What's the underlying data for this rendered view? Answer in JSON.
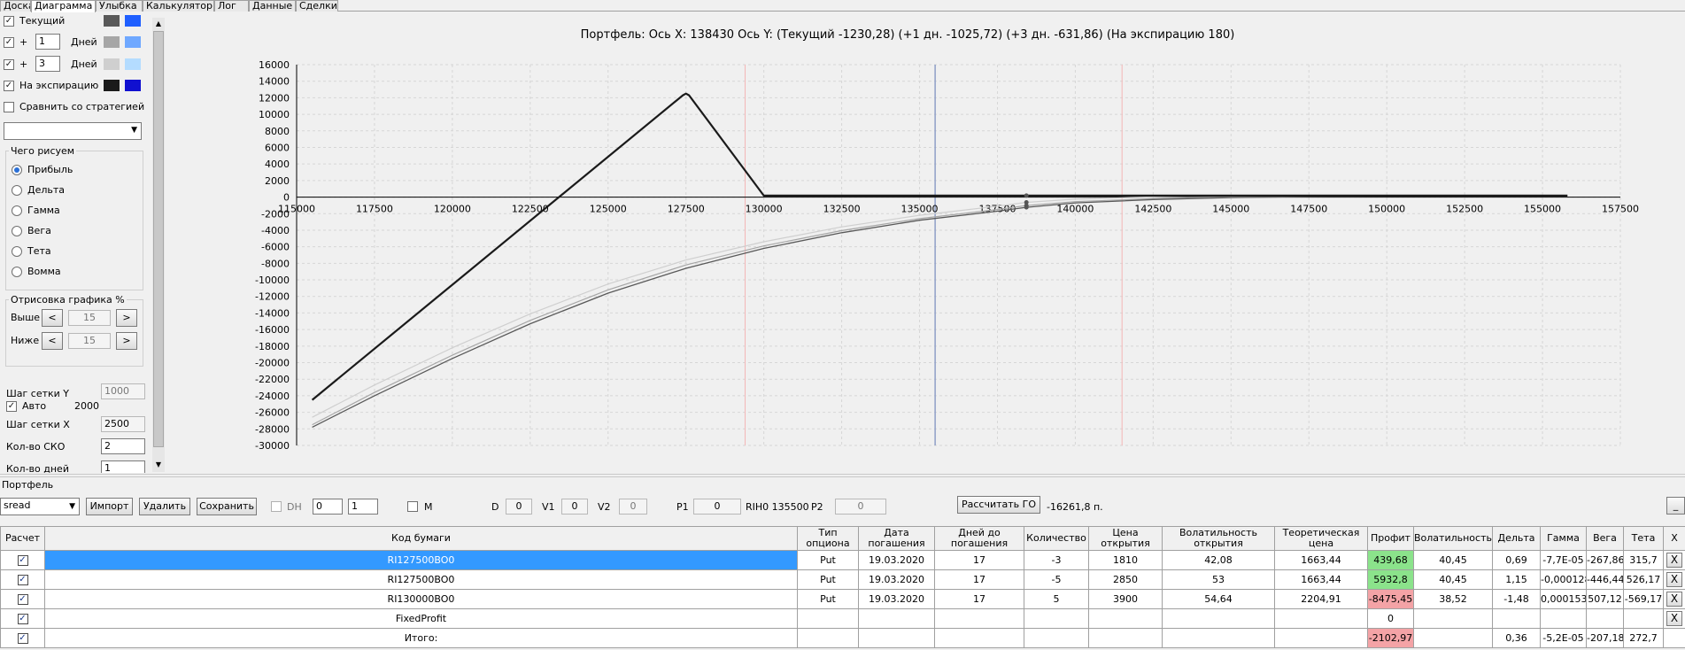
{
  "tabs": [
    "Доска",
    "Диаграмма",
    "Улыбка",
    "Калькулятор",
    "Лог",
    "Данные",
    "Сделки"
  ],
  "left_panel": {
    "current_label": "Текущий",
    "plus_sign": "+",
    "day1_value": "1",
    "day3_value": "3",
    "days_label": "Дней",
    "expiration_label": "На экспирацию",
    "compare_label": "Сравнить со стратегией",
    "what_draw_title": "Чего рисуем",
    "radio_options": [
      "Прибыль",
      "Дельта",
      "Гамма",
      "Вега",
      "Тета",
      "Вомма"
    ],
    "draw_pct_title": "Отрисовка графика %",
    "above_label": "Выше",
    "below_label": "Ниже",
    "above_value": "15",
    "below_value": "15",
    "btn_left": "<",
    "btn_right": ">",
    "grid_y_label": "Шаг сетки Y",
    "grid_y_value": "1000",
    "auto_label": "Авто",
    "auto_value": "2000",
    "grid_x_label": "Шаг сетки X",
    "grid_x_value": "2500",
    "sko_label": "Кол-во СКО",
    "sko_value": "2",
    "days_count_label": "Кол-во дней",
    "days_count_value": "1"
  },
  "colors": {
    "current_dark": "#595959",
    "current_light": "#1f5fff",
    "day1_dark": "#a6a6a6",
    "day1_light": "#6fa8ff",
    "day3_dark": "#cfcfcf",
    "day3_light": "#b4dcff",
    "exp_dark": "#1a1a1a",
    "exp_light": "#1010d0",
    "profit_green": "#8be38b",
    "profit_red": "#f4a3a6",
    "selected_row": "#3399ff"
  },
  "chart_data": {
    "type": "line",
    "title": "Портфель: Ось X: 138430 Ось Y: (Текущий -1230,28) (+1 дн. -1025,72) (+3 дн. -631,86) (На экспирацию 180)",
    "x_ticks": [
      115000,
      117500,
      120000,
      122500,
      125000,
      127500,
      130000,
      132500,
      135000,
      137500,
      140000,
      142500,
      145000,
      147500,
      150000,
      152500,
      155000,
      157500
    ],
    "y_ticks": [
      16000,
      14000,
      12000,
      10000,
      8000,
      6000,
      4000,
      2000,
      0,
      -2000,
      -4000,
      -6000,
      -8000,
      -10000,
      -12000,
      -14000,
      -16000,
      -18000,
      -20000,
      -22000,
      -24000,
      -26000,
      -28000,
      -30000
    ],
    "xlim": [
      115000,
      157500
    ],
    "ylim": [
      -30000,
      16000
    ],
    "grid": true,
    "vertical_lines": [
      {
        "x": 129400,
        "kind": "sigma"
      },
      {
        "x": 135500,
        "kind": "current"
      },
      {
        "x": 141500,
        "kind": "sigma"
      }
    ],
    "series": [
      {
        "key": "exp",
        "x": [
          115500,
          127400,
          127500,
          127600,
          130000,
          155800
        ],
        "y": [
          -24500,
          12300,
          12500,
          12300,
          180,
          180
        ]
      },
      {
        "key": "cur",
        "x": [
          115500,
          117500,
          120000,
          122500,
          125000,
          127500,
          130000,
          132500,
          135000,
          137500,
          138430,
          140000,
          142500,
          145000,
          147500,
          150000,
          152500,
          155800
        ],
        "y": [
          -27800,
          -24000,
          -19500,
          -15300,
          -11600,
          -8600,
          -6200,
          -4300,
          -2800,
          -1700,
          -1230,
          -700,
          -300,
          -60,
          60,
          120,
          150,
          180
        ]
      },
      {
        "key": "d1",
        "x": [
          115500,
          117500,
          120000,
          122500,
          125000,
          127500,
          130000,
          132500,
          135000,
          137500,
          138430,
          140000,
          142500,
          145000,
          147500,
          150000,
          152500,
          155800
        ],
        "y": [
          -27500,
          -23600,
          -19100,
          -14900,
          -11200,
          -8200,
          -5900,
          -4050,
          -2600,
          -1500,
          -1025,
          -550,
          -200,
          0,
          90,
          140,
          160,
          180
        ]
      },
      {
        "key": "d3",
        "x": [
          115500,
          117500,
          120000,
          122500,
          125000,
          127500,
          130000,
          132500,
          135000,
          137500,
          138430,
          140000,
          142500,
          145000,
          147500,
          150000,
          152500,
          155800
        ],
        "y": [
          -26600,
          -22700,
          -18200,
          -14100,
          -10500,
          -7600,
          -5400,
          -3600,
          -2200,
          -1100,
          -632,
          -250,
          20,
          140,
          180,
          190,
          190,
          190
        ]
      }
    ],
    "markers": [
      {
        "x": 138430,
        "y": 180
      },
      {
        "x": 138430,
        "y": -632
      },
      {
        "x": 138430,
        "y": -1025
      },
      {
        "x": 138430,
        "y": -1230
      }
    ]
  },
  "portfolio": {
    "title": "Портфель",
    "name": "sread",
    "import_btn": "Импорт",
    "delete_btn": "Удалить",
    "save_btn": "Сохранить",
    "dh_label": "DH",
    "spin1": "0",
    "spin2": "1",
    "m_label": "M",
    "d_label": "D",
    "d_value": "0",
    "v1_label": "V1",
    "v1_value": "0",
    "v2_label": "V2",
    "v2_value": "0",
    "p1_label": "P1",
    "p1_value": "0",
    "rih_text": "RIH0 135500",
    "p2_label": "P2",
    "p2_value": "0",
    "calc_go_btn": "Рассчитать ГО",
    "go_value": "-16261,8 п.",
    "min_btn": "_"
  },
  "table": {
    "headers": [
      "Расчет",
      "Код бумаги",
      "Тип опциона",
      "Дата погашения",
      "Дней до погашения",
      "Количество",
      "Цена открытия",
      "Волатильность открытия",
      "Теоретическая цена",
      "Профит",
      "Волатильность",
      "Дельта",
      "Гамма",
      "Вега",
      "Тета",
      "X"
    ],
    "rows": [
      {
        "code": "RI127500BO0",
        "type": "Put",
        "date": "19.03.2020",
        "days": "17",
        "qty": "-3",
        "open": "1810",
        "vol_open": "42,08",
        "theo": "1663,44",
        "profit": "439,68",
        "vol": "40,45",
        "delta": "0,69",
        "gamma": "-7,7E-05",
        "vega": "-267,86",
        "theta": "315,7",
        "x": "X",
        "profit_sign": "pos",
        "selected": true
      },
      {
        "code": "RI127500BO0",
        "type": "Put",
        "date": "19.03.2020",
        "days": "17",
        "qty": "-5",
        "open": "2850",
        "vol_open": "53",
        "theo": "1663,44",
        "profit": "5932,8",
        "vol": "40,45",
        "delta": "1,15",
        "gamma": "-0,000128",
        "vega": "-446,44",
        "theta": "526,17",
        "x": "X",
        "profit_sign": "pos",
        "selected": false
      },
      {
        "code": "RI130000BO0",
        "type": "Put",
        "date": "19.03.2020",
        "days": "17",
        "qty": "5",
        "open": "3900",
        "vol_open": "54,64",
        "theo": "2204,91",
        "profit": "-8475,45",
        "vol": "38,52",
        "delta": "-1,48",
        "gamma": "0,000153",
        "vega": "507,12",
        "theta": "-569,17",
        "x": "X",
        "profit_sign": "neg",
        "selected": false
      },
      {
        "code": "FixedProfit",
        "type": "",
        "date": "",
        "days": "",
        "qty": "",
        "open": "",
        "vol_open": "",
        "theo": "",
        "profit": "0",
        "vol": "",
        "delta": "",
        "gamma": "",
        "vega": "",
        "theta": "",
        "x": "X",
        "profit_sign": "zero",
        "selected": false
      },
      {
        "code": "Итого:",
        "type": "",
        "date": "",
        "days": "",
        "qty": "",
        "open": "",
        "vol_open": "",
        "theo": "",
        "profit": "-2102,97",
        "vol": "",
        "delta": "0,36",
        "gamma": "-5,2E-05",
        "vega": "-207,18",
        "theta": "272,7",
        "x": "",
        "profit_sign": "neg",
        "selected": false
      }
    ]
  }
}
